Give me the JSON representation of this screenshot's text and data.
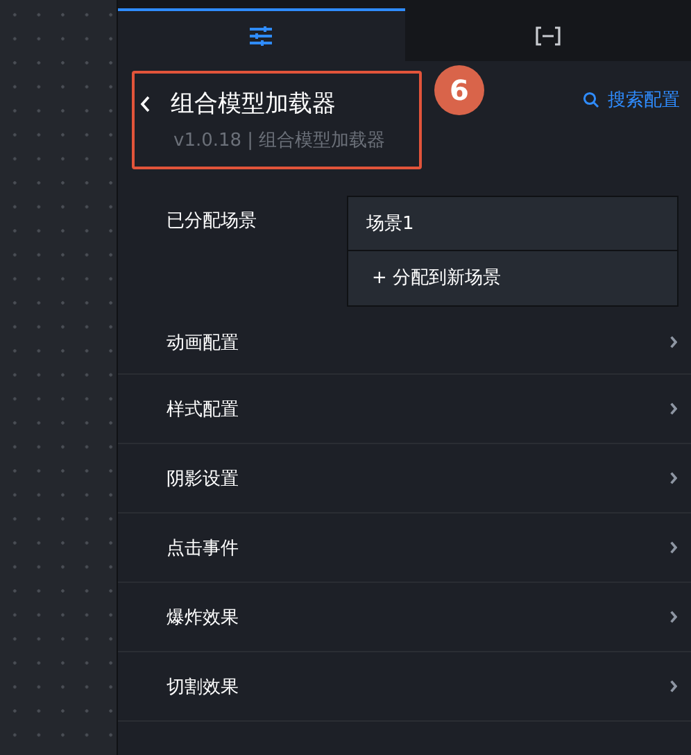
{
  "tabs": [
    {
      "kind": "sliders",
      "selected": true
    },
    {
      "kind": "bracket",
      "selected": false
    }
  ],
  "header": {
    "title": "组合模型加载器",
    "subtitle": "v1.0.18 | 组合模型加载器",
    "search": "搜索配置"
  },
  "callout": {
    "number": "6"
  },
  "assigned_scenes": {
    "label": "已分配场景",
    "scenes": [
      "场景1"
    ],
    "add": "+ 分配到新场景"
  },
  "sections": [
    {
      "label": "动画配置"
    },
    {
      "label": "样式配置"
    },
    {
      "label": "阴影设置"
    },
    {
      "label": "点击事件"
    },
    {
      "label": "爆炸效果"
    },
    {
      "label": "切割效果"
    }
  ]
}
